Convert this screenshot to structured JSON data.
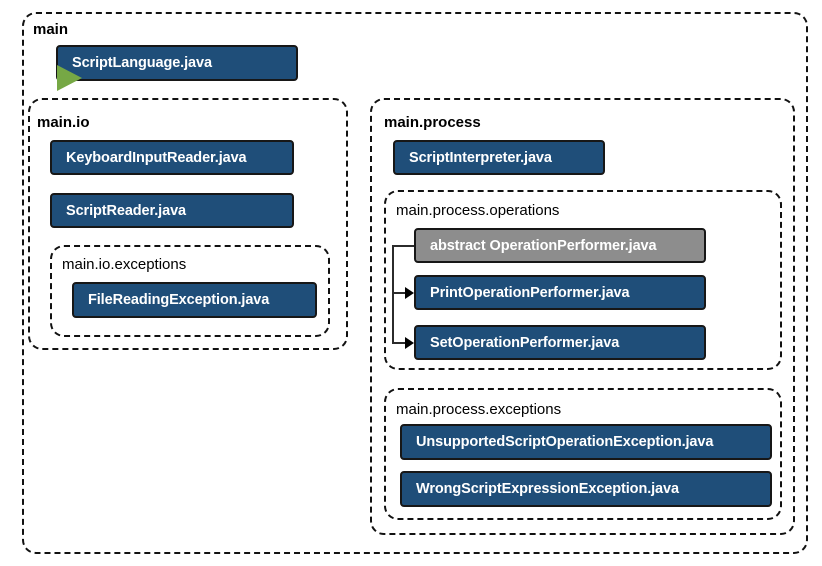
{
  "diagram": {
    "title_label": "main",
    "packages": [
      {
        "name": "main",
        "label": "main",
        "label_style": "bold"
      },
      {
        "name": "main.io",
        "label": "main.io",
        "label_style": "bold"
      },
      {
        "name": "main.io.exceptions",
        "label": "main.io.exceptions",
        "label_style": "plain"
      },
      {
        "name": "main.process",
        "label": "main.process",
        "label_style": "bold"
      },
      {
        "name": "main.process.operations",
        "label": "main.process.operations",
        "label_style": "plain"
      },
      {
        "name": "main.process.exceptions",
        "label": "main.process.exceptions",
        "label_style": "plain"
      }
    ],
    "classes": {
      "script_language": "ScriptLanguage.java",
      "keyboard_input_reader": "KeyboardInputReader.java",
      "script_reader": "ScriptReader.java",
      "file_reading_exception": "FileReadingException.java",
      "script_interpreter": "ScriptInterpreter.java",
      "operation_performer": "abstract OperationPerformer.java",
      "print_operation_performer": "PrintOperationPerformer.java",
      "set_operation_performer": "SetOperationPerformer.java",
      "unsupported_script_operation_exception": "UnsupportedScriptOperationException.java",
      "wrong_script_expression_exception": "WrongScriptExpressionException.java"
    },
    "colors": {
      "class_fill": "#1f4e79",
      "abstract_fill": "#8d8d8d",
      "class_border": "#171717",
      "run_marker": "#76a845",
      "package_border": "#111111",
      "text": "#ffffff",
      "label_text": "#000000",
      "connector": "#2b2b2b",
      "background": "#ffffff"
    },
    "icons": {
      "run_marker": "play-triangle-icon"
    }
  }
}
